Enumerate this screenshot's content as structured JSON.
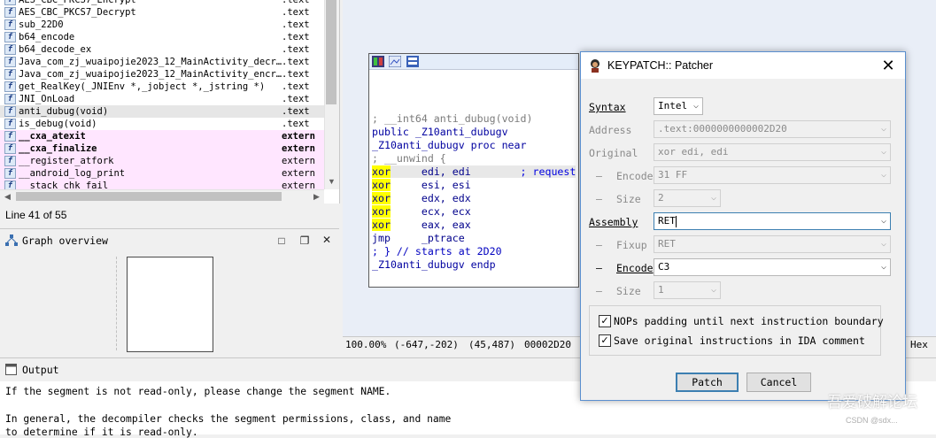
{
  "functions": [
    {
      "name": "AES_CBC_PKCS7_Encrypt",
      "seg": ".text",
      "style": "normal"
    },
    {
      "name": "AES_CBC_PKCS7_Decrypt",
      "seg": ".text",
      "style": "normal"
    },
    {
      "name": "sub_22D0",
      "seg": ".text",
      "style": "normal"
    },
    {
      "name": "b64_encode",
      "seg": ".text",
      "style": "normal"
    },
    {
      "name": "b64_decode_ex",
      "seg": ".text",
      "style": "normal"
    },
    {
      "name": "Java_com_zj_wuaipojie2023_12_MainActivity_decr…",
      "seg": ".text",
      "style": "normal"
    },
    {
      "name": "Java_com_zj_wuaipojie2023_12_MainActivity_encr…",
      "seg": ".text",
      "style": "normal"
    },
    {
      "name": "get_RealKey(_JNIEnv *,_jobject *,_jstring *)",
      "seg": ".text",
      "style": "normal"
    },
    {
      "name": "JNI_OnLoad",
      "seg": ".text",
      "style": "normal"
    },
    {
      "name": "anti_dubug(void)",
      "seg": ".text",
      "style": "selected"
    },
    {
      "name": "is_debug(void)",
      "seg": ".text",
      "style": "normal"
    },
    {
      "name": "__cxa_atexit",
      "seg": "extern",
      "style": "extern-bold"
    },
    {
      "name": "__cxa_finalize",
      "seg": "extern",
      "style": "extern-bold"
    },
    {
      "name": "__register_atfork",
      "seg": "extern",
      "style": "extern"
    },
    {
      "name": "__android_log_print",
      "seg": "extern",
      "style": "extern"
    },
    {
      "name": "__stack_chk_fail",
      "seg": "extern",
      "style": "extern"
    }
  ],
  "line_status": "Line 41 of 55",
  "graph_overview": {
    "title": "Graph overview"
  },
  "disasm": [
    {
      "text": "; __int64 anti_dubug(void)",
      "color": "#7b7b7b"
    },
    {
      "text": "public _Z10anti_dubugv",
      "color": "#0000a0"
    },
    {
      "text": "_Z10anti_dubugv proc near",
      "color": "#0000a0"
    },
    {
      "text": "; __unwind {",
      "color": "#7b7b7b"
    },
    {
      "mn": "xor",
      "ops": "     edi, edi        ",
      "cmt": "; request",
      "hl": true
    },
    {
      "mn": "xor",
      "ops": "     esi, esi",
      "hl": true
    },
    {
      "mn": "xor",
      "ops": "     edx, edx",
      "hl": true
    },
    {
      "mn": "xor",
      "ops": "     ecx, ecx",
      "hl": true
    },
    {
      "mn": "xor",
      "ops": "     eax, eax",
      "hl": true
    },
    {
      "mn": "jmp",
      "ops": "     _ptrace",
      "hl": false
    },
    {
      "text": "; } // starts at 2D20",
      "color": "#0000c0"
    },
    {
      "text": "_Z10anti_dubugv endp",
      "color": "#0000a0"
    }
  ],
  "status_bar": {
    "zoom": "100.00%",
    "coords": "(-647,-202)",
    "pos": "(45,487)",
    "addr": "00002D20",
    "hex_tab": "Hex"
  },
  "output": {
    "title": "Output",
    "lines": [
      "If the segment is not read-only, please change the segment NAME.",
      "",
      "In general, the decompiler checks the segment permissions, class, and name",
      "to determine if it is read-only."
    ]
  },
  "dialog": {
    "title": "KEYPATCH:: Patcher",
    "syntax_label": "Syntax",
    "syntax_value": "Intel",
    "address_label": "Address",
    "address_value": ".text:0000000000002D20",
    "original_label": "Original",
    "original_value": "xor edi, edi",
    "orig_encode_label": "Encode",
    "orig_encode_value": "31 FF",
    "orig_size_label": "Size",
    "orig_size_value": "2",
    "assembly_label": "Assembly",
    "assembly_value": "RET",
    "fixup_label": "Fixup",
    "fixup_value": "RET",
    "encode_label": "Encode",
    "encode_value": "C3",
    "size_label": "Size",
    "size_value": "1",
    "nop_padding_label": "NOPs padding until next instruction boundary",
    "save_original_label": "Save original instructions in IDA comment",
    "patch_button": "Patch",
    "cancel_button": "Cancel"
  },
  "watermark": "吾爱破解论坛",
  "watermark_sub": "CSDN @sdx..."
}
